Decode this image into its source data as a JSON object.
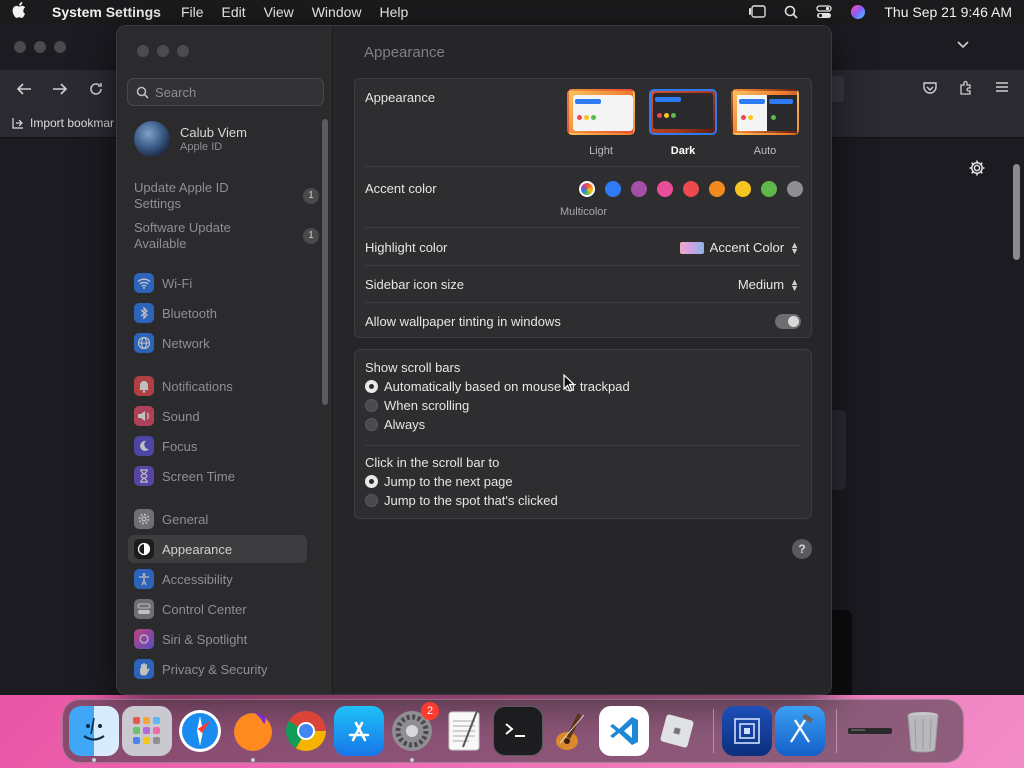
{
  "menubar": {
    "app_name": "System Settings",
    "menus": [
      "File",
      "Edit",
      "View",
      "Window",
      "Help"
    ],
    "clock": "Thu Sep 21  9:46 AM"
  },
  "browser": {
    "import_bookmarks": "Import bookmar"
  },
  "settings": {
    "search_placeholder": "Search",
    "profile": {
      "name": "Calub Viem",
      "sub": "Apple ID"
    },
    "notices": [
      {
        "label": "Update Apple ID Settings",
        "count": "1"
      },
      {
        "label": "Software Update Available",
        "count": "1"
      }
    ],
    "sidebar_items": [
      {
        "label": "Wi-Fi",
        "icon": "wifi-icon",
        "color": "#2f7bf5"
      },
      {
        "label": "Bluetooth",
        "icon": "bluetooth-icon",
        "color": "#2f7bf5"
      },
      {
        "label": "Network",
        "icon": "globe-icon",
        "color": "#2f7bf5"
      },
      {
        "label": "Notifications",
        "icon": "bell-icon",
        "color": "#e84a4a"
      },
      {
        "label": "Sound",
        "icon": "speaker-icon",
        "color": "#e84a6a"
      },
      {
        "label": "Focus",
        "icon": "moon-icon",
        "color": "#5b50d6"
      },
      {
        "label": "Screen Time",
        "icon": "hourglass-icon",
        "color": "#6b4fd8"
      },
      {
        "label": "General",
        "icon": "gear-icon",
        "color": "#8e8e93"
      },
      {
        "label": "Appearance",
        "icon": "appearance-icon",
        "color": "#1c1c1e"
      },
      {
        "label": "Accessibility",
        "icon": "accessibility-icon",
        "color": "#2f7bf5"
      },
      {
        "label": "Control Center",
        "icon": "control-center-icon",
        "color": "#8e8e93"
      },
      {
        "label": "Siri & Spotlight",
        "icon": "siri-icon",
        "color": "#b24fd8"
      },
      {
        "label": "Privacy & Security",
        "icon": "hand-icon",
        "color": "#2f7bf5"
      }
    ],
    "active_item": "Appearance"
  },
  "appearance": {
    "page_title": "Appearance",
    "appearance_label": "Appearance",
    "themes": [
      {
        "label": "Light",
        "selected": false
      },
      {
        "label": "Dark",
        "selected": true
      },
      {
        "label": "Auto",
        "selected": false
      }
    ],
    "accent_label": "Accent color",
    "accent_selected_name": "Multicolor",
    "accent_colors": [
      "#2f7bf5",
      "#a550a7",
      "#e94f98",
      "#ec4a4e",
      "#f38a1f",
      "#f7c51f",
      "#5fb84a",
      "#8e8e93"
    ],
    "highlight_label": "Highlight color",
    "highlight_value": "Accent Color",
    "sidebar_size_label": "Sidebar icon size",
    "sidebar_size_value": "Medium",
    "tinting_label": "Allow wallpaper tinting in windows",
    "tinting_on": true,
    "scroll_bars_label": "Show scroll bars",
    "scroll_bar_options": [
      {
        "label": "Automatically based on mouse or trackpad",
        "selected": true
      },
      {
        "label": "When scrolling",
        "selected": false
      },
      {
        "label": "Always",
        "selected": false
      }
    ],
    "click_label": "Click in the scroll bar to",
    "click_options": [
      {
        "label": "Jump to the next page",
        "selected": true
      },
      {
        "label": "Jump to the spot that's clicked",
        "selected": false
      }
    ],
    "help": "?"
  },
  "dock": {
    "apps": [
      {
        "name": "finder-icon"
      },
      {
        "name": "launchpad-icon"
      },
      {
        "name": "safari-icon"
      },
      {
        "name": "firefox-icon"
      },
      {
        "name": "chrome-icon"
      },
      {
        "name": "app-store-icon"
      },
      {
        "name": "system-settings-icon",
        "badge": "2"
      },
      {
        "name": "textedit-icon"
      },
      {
        "name": "terminal-icon"
      },
      {
        "name": "garageband-icon"
      },
      {
        "name": "vscode-icon"
      },
      {
        "name": "roblox-icon"
      },
      {
        "name": "screen-sharing-icon"
      },
      {
        "name": "xcode-icon"
      },
      {
        "name": "downloads-stack-icon"
      },
      {
        "name": "trash-icon"
      }
    ]
  }
}
